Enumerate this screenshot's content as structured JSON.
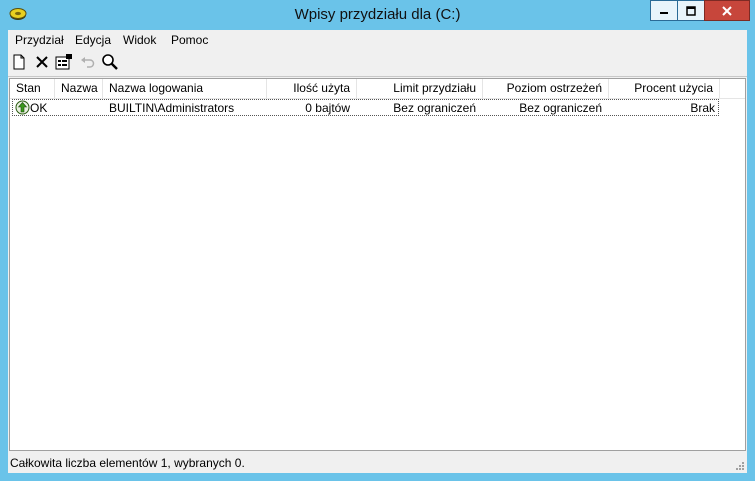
{
  "window": {
    "title": "Wpisy przydziału dla  (C:)",
    "icon": "disk-quota-icon"
  },
  "menu": [
    {
      "label": "Przydział"
    },
    {
      "label": "Edycja"
    },
    {
      "label": "Widok"
    },
    {
      "label": "Pomoc"
    }
  ],
  "toolbar": {
    "icons": [
      "new-document-icon",
      "delete-icon",
      "properties-icon",
      "undo-icon",
      "search-icon"
    ]
  },
  "columns": [
    {
      "label": "Stan"
    },
    {
      "label": "Nazwa"
    },
    {
      "label": "Nazwa logowania"
    },
    {
      "label": "Ilość użyta"
    },
    {
      "label": "Limit przydziału"
    },
    {
      "label": "Poziom ostrzeżeń"
    },
    {
      "label": "Procent użycia"
    }
  ],
  "rows": [
    {
      "status_icon": "ok-status-icon",
      "status": "OK",
      "name": "",
      "login": "BUILTIN\\Administrators",
      "used": "0 bajtów",
      "limit": "Bez ograniczeń",
      "warning": "Bez ograniczeń",
      "percent": "Brak"
    }
  ],
  "statusbar": {
    "text": "Całkowita liczba elementów 1, wybranych 0."
  },
  "colors": {
    "frame": "#6ac3e9",
    "close_button": "#c7463b",
    "client": "#f0f0f0"
  }
}
